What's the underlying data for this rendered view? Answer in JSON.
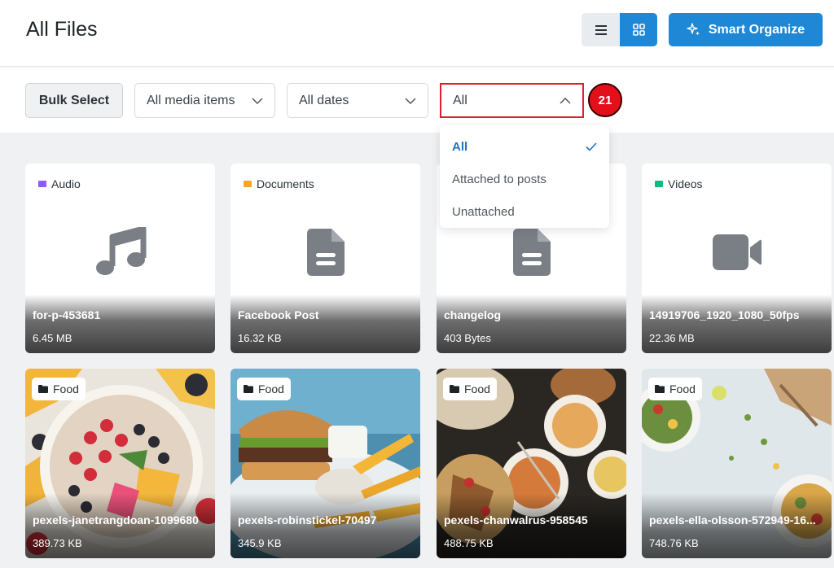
{
  "header": {
    "title": "All Files",
    "smart_organize": "Smart Organize"
  },
  "toolbar": {
    "bulk_select": "Bulk Select",
    "media_filter": "All media items",
    "date_filter": "All dates",
    "attach_filter": "All",
    "badge": "21"
  },
  "dropdown": {
    "items": [
      {
        "label": "All",
        "selected": true
      },
      {
        "label": "Attached to posts",
        "selected": false
      },
      {
        "label": "Unattached",
        "selected": false
      }
    ]
  },
  "files": [
    {
      "tag": "Audio",
      "tag_color": "#8b5cf6",
      "name": "for-p-453681",
      "size": "6.45 MB",
      "icon": "music-note-icon"
    },
    {
      "tag": "Documents",
      "tag_color": "#f5a623",
      "name": "Facebook Post",
      "size": "16.32 KB",
      "icon": "document-icon"
    },
    {
      "tag": "",
      "tag_color": "",
      "name": "changelog",
      "size": "403 Bytes",
      "icon": "document-icon"
    },
    {
      "tag": "Videos",
      "tag_color": "#10b981",
      "name": "14919706_1920_1080_50fps",
      "size": "22.36 MB",
      "icon": "video-camera-icon"
    },
    {
      "tag": "Food",
      "name": "pexels-janetrangdoan-1099680",
      "size": "389.73 KB",
      "icon": "folder-icon"
    },
    {
      "tag": "Food",
      "name": "pexels-robinstickel-70497",
      "size": "345.9 KB",
      "icon": "folder-icon"
    },
    {
      "tag": "Food",
      "name": "pexels-chanwalrus-958545",
      "size": "488.75 KB",
      "icon": "folder-icon"
    },
    {
      "tag": "Food",
      "name": "pexels-ella-olsson-572949-16...",
      "size": "748.76 KB",
      "icon": "folder-icon"
    }
  ]
}
